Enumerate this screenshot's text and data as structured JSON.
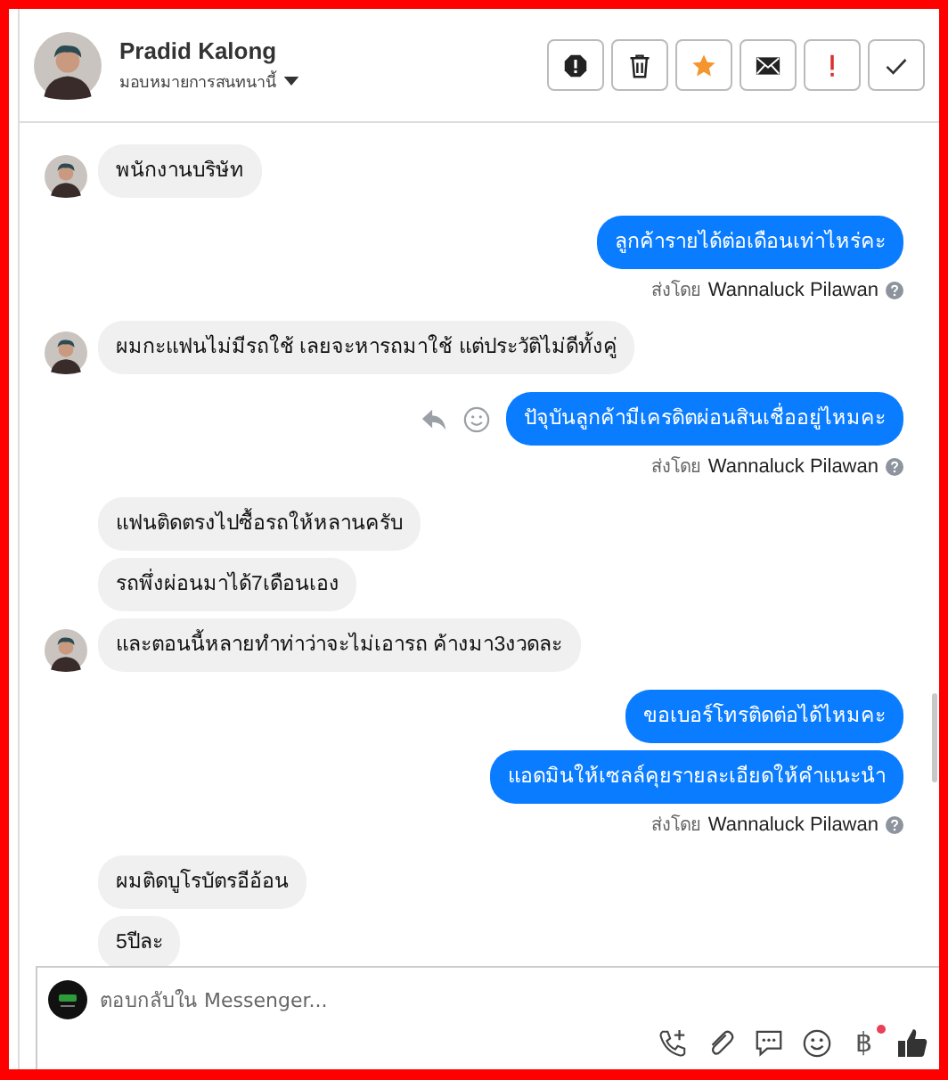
{
  "header": {
    "name": "Pradid Kalong",
    "assign_label": "มอบหมายการสนทนานี้",
    "actions": [
      {
        "kind": "octagon-alert"
      },
      {
        "kind": "trash"
      },
      {
        "kind": "star"
      },
      {
        "kind": "envelope"
      },
      {
        "kind": "exclamation"
      },
      {
        "kind": "check"
      }
    ]
  },
  "messages": [
    {
      "kind": "incoming",
      "text": "พนักงานบริษัท",
      "avatar": true
    },
    {
      "kind": "outgoing",
      "text": "ลูกค้ารายได้ต่อเดือนเท่าไหร่คะ",
      "hover_actions": false
    },
    {
      "kind": "sent_by",
      "label": "ส่งโดย",
      "name": "Wannaluck Pilawan"
    },
    {
      "kind": "incoming",
      "text": "ผมกะแฟนไม่มีรถใช้ เลยจะหารถมาใช้ แต่ประวัติไม่ดีทั้งคู่",
      "avatar": true
    },
    {
      "kind": "outgoing",
      "text": "ปัจุบันลูกค้ามีเครดิตผ่อนสินเชื่ออยู่ไหมคะ",
      "hover_actions": true
    },
    {
      "kind": "sent_by",
      "label": "ส่งโดย",
      "name": "Wannaluck Pilawan"
    },
    {
      "kind": "incoming",
      "text": "แฟนติดตรงไปซื้อรถให้หลานครับ",
      "avatar": false
    },
    {
      "kind": "incoming",
      "text": "รถพึ่งผ่อนมาได้7เดือนเอง",
      "avatar": false
    },
    {
      "kind": "incoming",
      "text": "และตอนนี้หลายทำท่าว่าจะไม่เอารถ ค้างมา3งวดละ",
      "avatar": true
    },
    {
      "kind": "outgoing",
      "text": "ขอเบอร์โทรติดต่อได้ไหมคะ",
      "hover_actions": false
    },
    {
      "kind": "outgoing",
      "text": "แอดมินให้เซลล์คุยรายละเอียดให้คำแนะนำ",
      "hover_actions": false
    },
    {
      "kind": "sent_by",
      "label": "ส่งโดย",
      "name": "Wannaluck Pilawan"
    },
    {
      "kind": "incoming",
      "text": "ผมติดบูโรบัตรอีอ้อน",
      "avatar": false
    },
    {
      "kind": "incoming",
      "text": "5ปีละ",
      "avatar": false
    }
  ],
  "composer": {
    "placeholder": "ตอบกลับใน Messenger...",
    "currency_symbol": "฿",
    "currency_notification": true
  }
}
